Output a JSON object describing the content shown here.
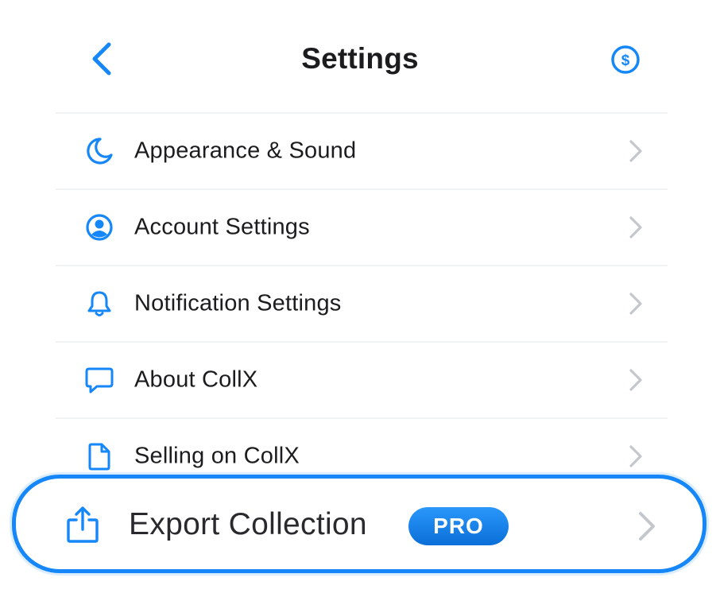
{
  "header": {
    "title": "Settings",
    "back_icon": "chevron-left-icon",
    "coin_icon": "dollar-coin-icon"
  },
  "menu": {
    "items": [
      {
        "label": "Appearance & Sound",
        "icon": "moon-icon"
      },
      {
        "label": "Account Settings",
        "icon": "user-circle-icon"
      },
      {
        "label": "Notification Settings",
        "icon": "bell-icon"
      },
      {
        "label": "About CollX",
        "icon": "chat-bubble-icon"
      },
      {
        "label": "Selling on CollX",
        "icon": "document-icon"
      }
    ]
  },
  "export": {
    "label": "Export Collection",
    "badge": "PRO",
    "icon": "share-export-icon"
  },
  "colors": {
    "accent": "#1587f8",
    "text": "#1c1c1e",
    "chevron": "#c4c7cc",
    "divider": "#f0f2f4"
  }
}
